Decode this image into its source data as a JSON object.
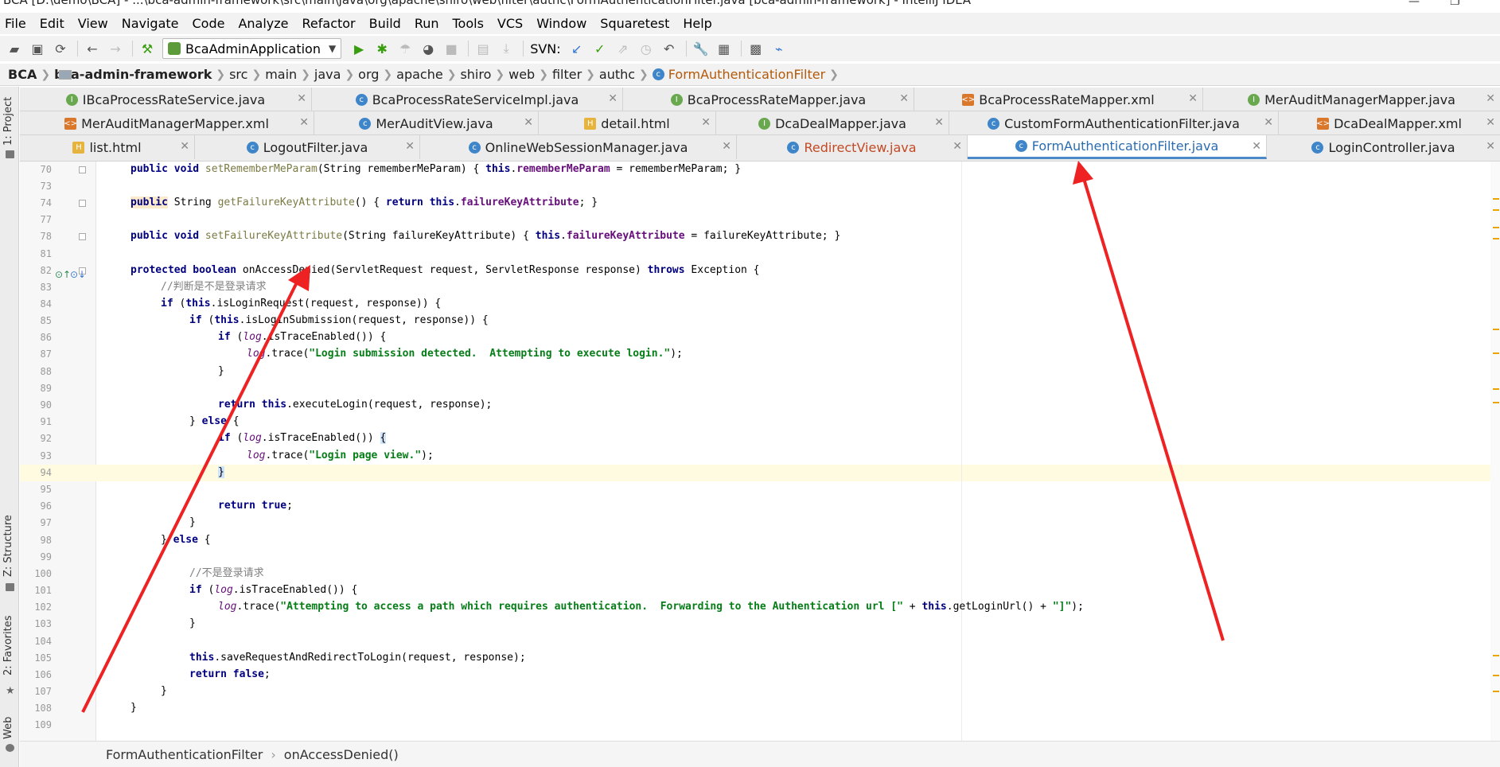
{
  "window": {
    "title": "BCA [D:\\demo\\BCA] - ...\\bca-admin-framework\\src\\main\\java\\org\\apache\\shiro\\web\\filter\\authc\\FormAuthenticationFilter.java [bca-admin-framework] - IntelliJ IDEA"
  },
  "menu": {
    "items": [
      "File",
      "Edit",
      "View",
      "Navigate",
      "Code",
      "Analyze",
      "Refactor",
      "Build",
      "Run",
      "Tools",
      "VCS",
      "Window",
      "Squaretest",
      "Help"
    ]
  },
  "toolbar": {
    "run_config": "BcaAdminApplication",
    "svn_label": "SVN:"
  },
  "breadcrumb": {
    "items": [
      "BCA",
      "bca-admin-framework",
      "src",
      "main",
      "java",
      "org",
      "apache",
      "shiro",
      "web",
      "filter",
      "authc",
      "FormAuthenticationFilter"
    ]
  },
  "left_stripe": {
    "project": "1: Project",
    "structure": "Z: Structure",
    "favorites": "2: Favorites",
    "web": "Web"
  },
  "tabs": {
    "row1": [
      "IBcaProcessRateService.java",
      "BcaProcessRateServiceImpl.java",
      "BcaProcessRateMapper.java",
      "BcaProcessRateMapper.xml",
      "MerAuditManagerMapper.java"
    ],
    "row2": [
      "MerAuditManagerMapper.xml",
      "MerAuditView.java",
      "detail.html",
      "DcaDealMapper.java",
      "CustomFormAuthenticationFilter.java",
      "DcaDealMapper.xml"
    ],
    "row3": [
      "list.html",
      "LogoutFilter.java",
      "OnlineWebSessionManager.java",
      "RedirectView.java",
      "FormAuthenticationFilter.java",
      "LoginController.java"
    ]
  },
  "editor": {
    "line_numbers": [
      "70",
      "73",
      "74",
      "77",
      "78",
      "81",
      "82",
      "83",
      "84",
      "85",
      "86",
      "87",
      "88",
      "89",
      "90",
      "91",
      "92",
      "93",
      "94",
      "95",
      "96",
      "97",
      "98",
      "99",
      "100",
      "101",
      "102",
      "103",
      "104",
      "105",
      "106",
      "107",
      "108",
      "109"
    ],
    "comment_login": "//判断是不是登录请求",
    "comment_not_login": "//不是登录请求",
    "str_submission": "\"Login submission detected.  Attempting to execute login.\"",
    "str_page_view": "\"Login page view.\"",
    "str_access": "\"Attempting to access a path which requires authentication.  Forwarding to the Authentication url [\"",
    "str_close": "\"]\""
  },
  "status": {
    "class_crumb": "FormAuthenticationFilter",
    "method_crumb": "onAccessDenied()"
  },
  "colors": {
    "keyword": "#000080",
    "string": "#067d17",
    "field": "#660e7a",
    "comment": "#808080",
    "arrow": "#ee2222",
    "active_tab": "#4a88c7"
  }
}
